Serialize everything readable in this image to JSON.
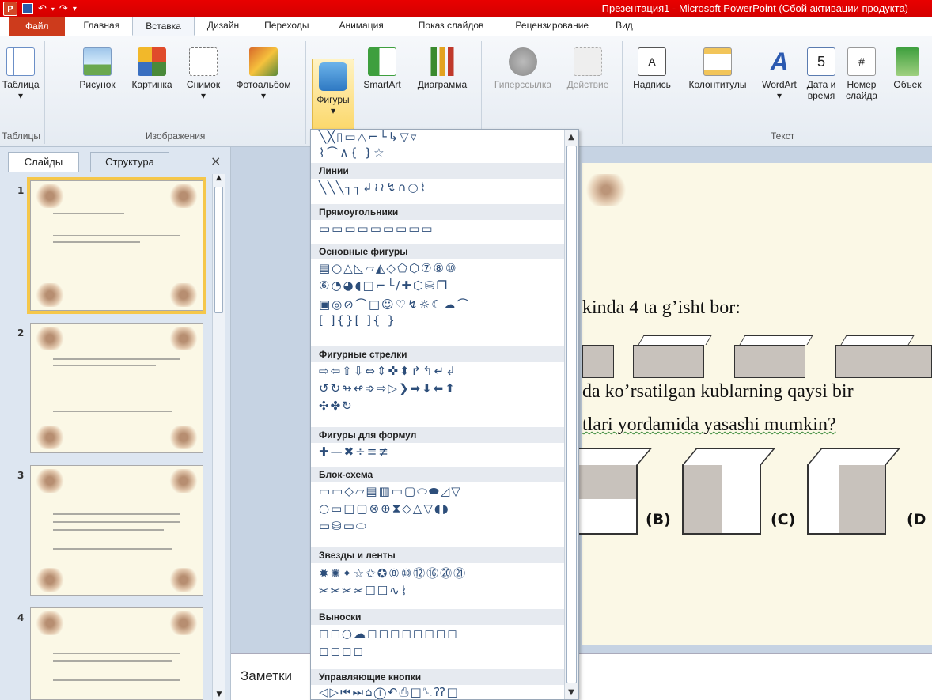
{
  "window": {
    "title": "Презентация1  -  Microsoft PowerPoint (Сбой активации продукта)",
    "logo_letter": "P"
  },
  "tabs": {
    "file": "Файл",
    "items": [
      "Главная",
      "Вставка",
      "Дизайн",
      "Переходы",
      "Анимация",
      "Показ слайдов",
      "Рецензирование",
      "Вид"
    ],
    "active": "Вставка"
  },
  "ribbon": {
    "buttons": {
      "table": "Таблица",
      "picture": "Рисунок",
      "clipart": "Картинка",
      "screenshot": "Снимок",
      "album": "Фотоальбом",
      "shapes": "Фигуры",
      "smartart": "SmartArt",
      "chart": "Диаграмма",
      "hyperlink": "Гиперссылка",
      "action": "Действие",
      "textbox": "Надпись",
      "headerfooter": "Колонтитулы",
      "wordart": "WordArt",
      "datetime_1": "Дата и",
      "datetime_2": "время",
      "slidenum_1": "Номер",
      "slidenum_2": "слайда",
      "object": "Объек"
    },
    "groups": {
      "tables": "Таблицы",
      "images": "Изображения",
      "text": "Текст"
    }
  },
  "panel": {
    "tab_slides": "Слайды",
    "tab_outline": "Структура",
    "close": "×",
    "slide_numbers": [
      "1",
      "2",
      "3",
      "4"
    ]
  },
  "slide": {
    "line1": "kinda 4 ta g’isht bor:",
    "line2": "da ko’rsatilgan kublarning qaysi bir",
    "line3": "tlari yordamida yasashi mumkin?",
    "opt_b": "(B)",
    "opt_c": "(C)",
    "opt_d": "(D"
  },
  "notes": {
    "label": "Заметки"
  },
  "gallery": {
    "top_row": "╲╳▯▭△⌐└↳▽▿",
    "top_row2": "⌇⌒∧{ }☆",
    "sections": {
      "lines": "Линии",
      "rectangles": "Прямоугольники",
      "basic": "Основные фигуры",
      "arrows": "Фигурные стрелки",
      "equation": "Фигуры для формул",
      "flowchart": "Блок-схема",
      "stars": "Звезды и ленты",
      "callouts": "Выноски",
      "action": "Управляющие кнопки"
    },
    "rows": {
      "lines": "╲╲╲┐┐↲≀≀↯∩○⌇",
      "rectangles": "▭▭▭▭▭▭▭▭▭",
      "basic1": "▤○△◺▱◭◇⬠⬡⑦⑧⑩",
      "basic2": "⑥◔◕◖□⌐└∕✚⬡⛁❐",
      "basic3": "▣◎⊘⌒□☺♡↯☼☾☁⌒",
      "basic4": "[ ]{}[ ]{ }",
      "arrows1": "⇨⇦⇧⇩⇔⇕✜⬍↱↰↵↲",
      "arrows2": "↺↻↬↫➩⇨▷❯➡⬇⬅⬆",
      "arrows3": "✣✤↻",
      "equation": "✚—✖÷≡≢",
      "flow1": "▭▭◇▱▤▥▭▢⬭⬬◿▽",
      "flow2": "○▭□▢⊗⊕⧗◇△▽◖◗",
      "flow3": "▭⛁▭⬭",
      "stars1": "✹✺✦☆✩✪⑧⑩⑫⑯⑳㉑",
      "stars2": "✂✂✂✂☐☐∿⌇",
      "callouts1": "◻◻○☁◻◻◻◻◻◻◻◻",
      "callouts2": "◻◻◻◻",
      "action": "◁▷⏮⏭⌂ⓘ↶⎙□␇⁇□"
    }
  }
}
